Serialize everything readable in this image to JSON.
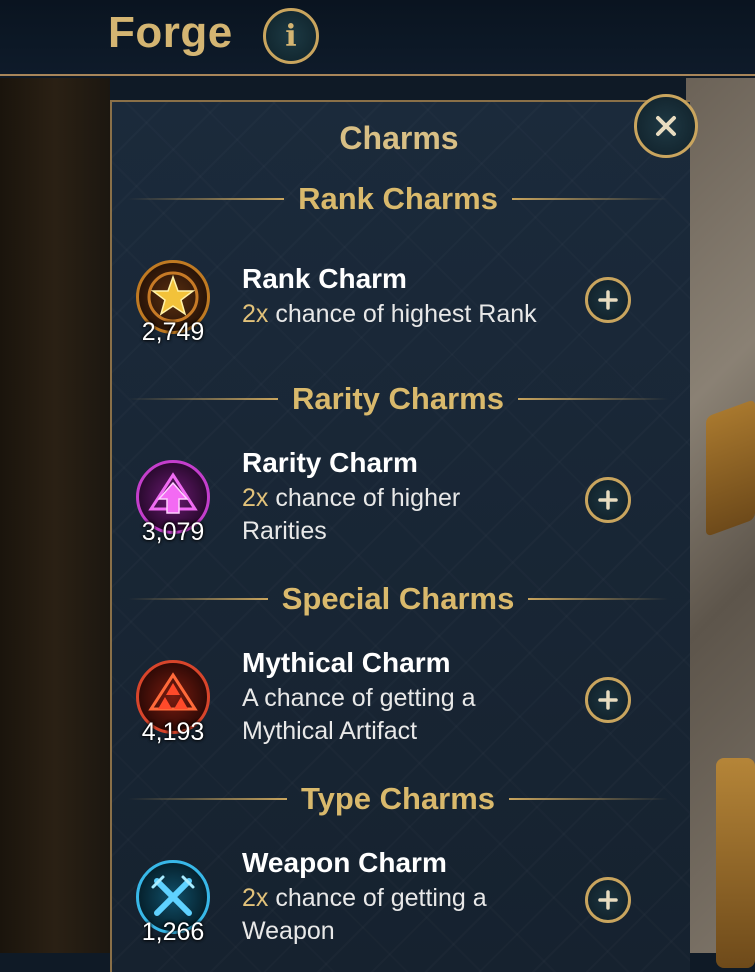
{
  "header": {
    "title": "Forge",
    "info_icon": "info-icon"
  },
  "panel": {
    "title": "Charms",
    "close_icon": "close-icon"
  },
  "sections": [
    {
      "title": "Rank Charms",
      "charm": {
        "name": "Rank Charm",
        "count": "2,749",
        "desc_accent": "2x",
        "desc_line1": " chance of highest Rank",
        "desc_line2": "",
        "icon": "star-icon",
        "color": "#d9a12e"
      }
    },
    {
      "title": "Rarity Charms",
      "charm": {
        "name": "Rarity Charm",
        "count": "3,079",
        "desc_accent": "2x",
        "desc_line1": " chance of higher",
        "desc_line2": "Rarities",
        "icon": "arrow-up-icon",
        "color": "#d43ad6"
      }
    },
    {
      "title": "Special Charms",
      "charm": {
        "name": "Mythical Charm",
        "count": "4,193",
        "desc_accent": "",
        "desc_line1": "A chance of getting a",
        "desc_line2": "Mythical Artifact",
        "icon": "triangles-icon",
        "color": "#e0442a"
      }
    },
    {
      "title": "Type Charms",
      "charm": {
        "name": "Weapon Charm",
        "count": "1,266",
        "desc_accent": "2x",
        "desc_line1": " chance of getting a",
        "desc_line2": "Weapon",
        "icon": "crossed-swords-icon",
        "color": "#2fb6e6"
      }
    }
  ]
}
